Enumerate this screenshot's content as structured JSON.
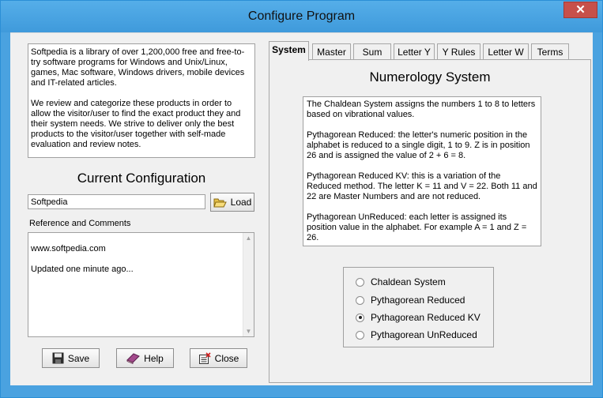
{
  "window": {
    "title": "Configure Program",
    "close_glyph": "✕"
  },
  "intro": {
    "paragraphs": [
      "Softpedia is a library of over 1,200,000 free and free-to-try software programs for Windows and Unix/Linux, games, Mac software, Windows drivers, mobile devices and IT-related articles.",
      "We review and categorize these products in order to allow the visitor/user to find the exact product they and their system needs. We strive to deliver only the best products to the visitor/user together with self-made evaluation and review notes."
    ]
  },
  "current_config": {
    "heading": "Current Configuration",
    "value": "Softpedia",
    "load_label": "Load"
  },
  "reference": {
    "label": "Reference and Comments",
    "lines": [
      "www.softpedia.com",
      "Updated one minute ago..."
    ]
  },
  "buttons": {
    "save": "Save",
    "help": "Help",
    "close": "Close"
  },
  "tabs": [
    "System",
    "Master",
    "Sum",
    "Letter Y",
    "Y Rules",
    "Letter W",
    "Terms"
  ],
  "active_tab": "System",
  "system_panel": {
    "heading": "Numerology System",
    "paragraphs": [
      "The Chaldean System assigns the numbers 1 to 8 to letters based on vibrational values.",
      "Pythagorean Reduced:  the letter's numeric position in the alphabet is reduced to a single digit, 1 to 9.  Z is in position 26 and is assigned the value of 2 + 6 = 8.",
      "Pythagorean Reduced KV:  this is a variation of the Reduced method.  The letter K = 11 and V = 22.  Both 11 and 22 are Master Numbers and are not reduced.",
      "Pythagorean UnReduced:  each letter is assigned its position value in the alphabet.  For example A = 1 and  Z = 26."
    ],
    "options": [
      "Chaldean System",
      "Pythagorean Reduced",
      "Pythagorean Reduced KV",
      "Pythagorean UnReduced"
    ],
    "selected_option": "Pythagorean Reduced KV"
  },
  "icons": {
    "load": "folder-open-icon",
    "save": "floppy-disk-icon",
    "help": "help-book-icon",
    "close": "close-document-icon"
  }
}
